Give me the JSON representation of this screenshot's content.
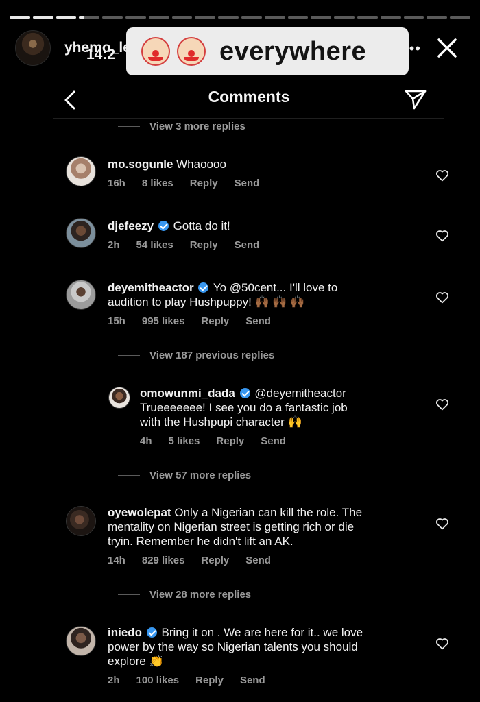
{
  "story": {
    "username": "yhemo_lee",
    "time": "14:2",
    "more": "•••",
    "progress_segments": 20,
    "current_segment": 3,
    "current_fraction": 0.25
  },
  "sticker": {
    "text": "everywhere",
    "emoji": "clown-face"
  },
  "header": {
    "title": "Comments"
  },
  "view_more": [
    {
      "label": "View 3 more replies"
    },
    {
      "label": "View 187 previous replies"
    },
    {
      "label": "View 57 more replies"
    },
    {
      "label": "View 28 more replies"
    }
  ],
  "comments": [
    {
      "username": "mo.sogunle",
      "verified": false,
      "lines": [
        "Whaoooo"
      ],
      "time": "16h",
      "likes": "8 likes",
      "reply": "Reply",
      "send": "Send"
    },
    {
      "username": "djefeezy",
      "verified": true,
      "lines": [
        "Gotta do it!"
      ],
      "time": "2h",
      "likes": "54 likes",
      "reply": "Reply",
      "send": "Send"
    },
    {
      "username": "deyemitheactor",
      "verified": true,
      "lines": [
        "Yo @50cent... I'll love to",
        "audition to play Hushpuppy! 🙌🏾 🙌🏾 🙌🏾"
      ],
      "time": "15h",
      "likes": "995 likes",
      "reply": "Reply",
      "send": "Send"
    },
    {
      "username": "omowunmi_dada",
      "verified": true,
      "lines": [
        "@deyemitheactor",
        "Trueeeeeee! I see you do a fantastic job",
        "with the Hushpupi character 🙌"
      ],
      "time": "4h",
      "likes": "5 likes",
      "reply": "Reply",
      "send": "Send"
    },
    {
      "username": "oyewolepat",
      "verified": false,
      "lines": [
        "Only a Nigerian can kill the role. The",
        "mentality on Nigerian street is getting rich or die",
        "tryin. Remember he didn't lift an AK."
      ],
      "time": "14h",
      "likes": "829 likes",
      "reply": "Reply",
      "send": "Send"
    },
    {
      "username": "iniedo",
      "verified": true,
      "lines": [
        "Bring it on . We are here for it.. we love",
        "power by the way so Nigerian talents you should",
        "explore 👏"
      ],
      "time": "2h",
      "likes": "100 likes",
      "reply": "Reply",
      "send": "Send"
    }
  ],
  "colors": {
    "background": "#000000",
    "text": "#f1f1f1",
    "muted": "#9a9a9a",
    "verified": "#3897f0"
  }
}
